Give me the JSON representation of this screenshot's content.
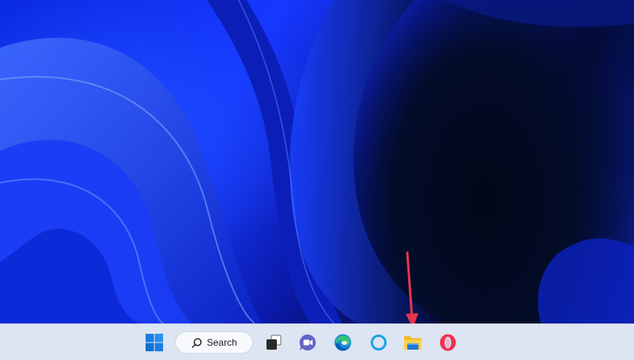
{
  "taskbar": {
    "search": {
      "label": "Search",
      "icon": "search-icon"
    },
    "items": [
      {
        "name": "start-button",
        "icon": "windows-logo-icon"
      },
      {
        "name": "task-view-button",
        "icon": "task-view-icon"
      },
      {
        "name": "chat-button",
        "icon": "teams-chat-icon"
      },
      {
        "name": "edge-button",
        "icon": "edge-icon"
      },
      {
        "name": "cortana-button",
        "icon": "cortana-icon"
      },
      {
        "name": "file-explorer-button",
        "icon": "folder-icon"
      },
      {
        "name": "opera-button",
        "icon": "opera-icon"
      }
    ]
  },
  "annotation": {
    "target": "file-explorer-button",
    "color": "#e8344e"
  },
  "colors": {
    "taskbar": "#dde4f2",
    "accent": "#0a5ad4",
    "wallpaper": "#1638ff"
  }
}
